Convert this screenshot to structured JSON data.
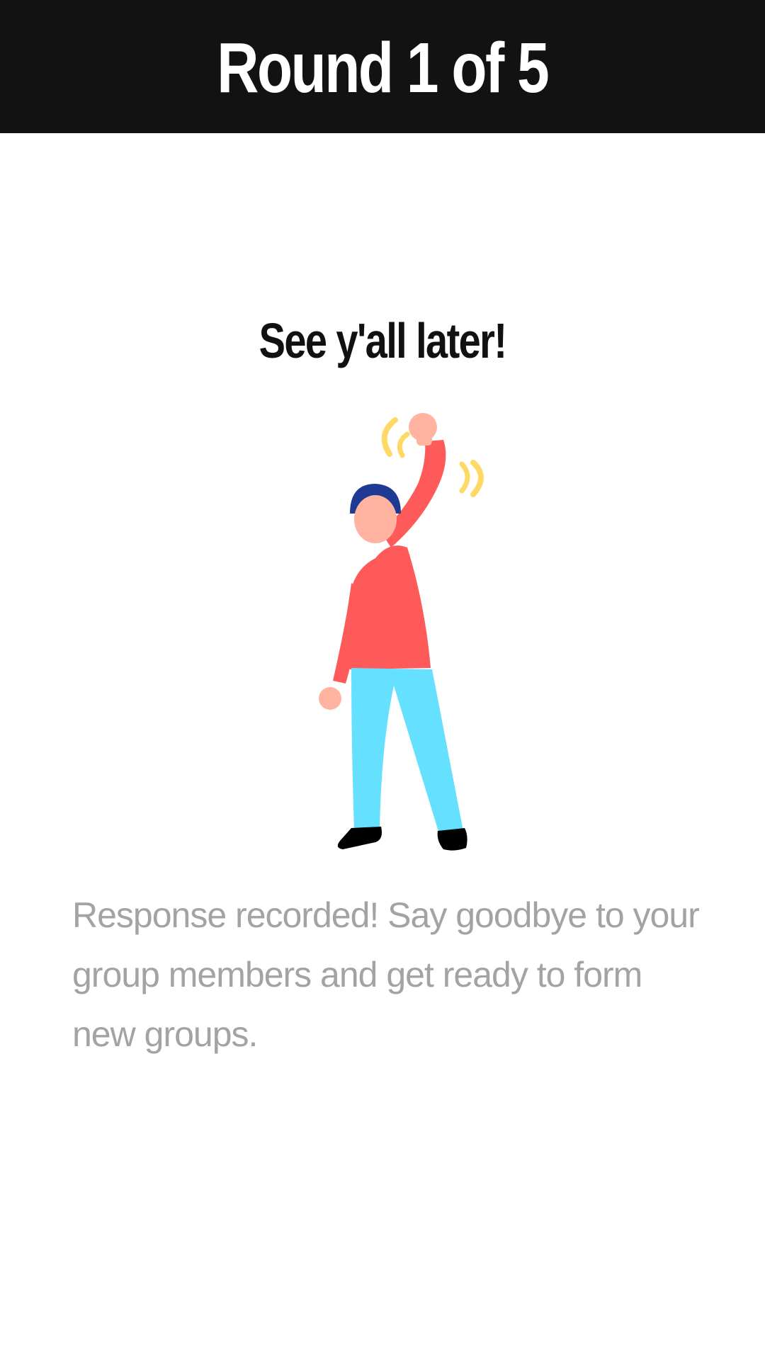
{
  "header": {
    "round_label": "Round 1 of 5"
  },
  "main": {
    "subtitle": "See y'all later!",
    "illustration_icon": "waving-person-icon",
    "message": "Response recorded! Say goodbye to your group members and get ready to form new groups."
  },
  "colors": {
    "header_bg": "#121212",
    "shirt": "#ff5a5a",
    "pants": "#66e0ff",
    "skin": "#ffb3a0",
    "hair": "#1f3a93",
    "wave_lines": "#ffd966",
    "message_text": "#a3a3a3"
  }
}
